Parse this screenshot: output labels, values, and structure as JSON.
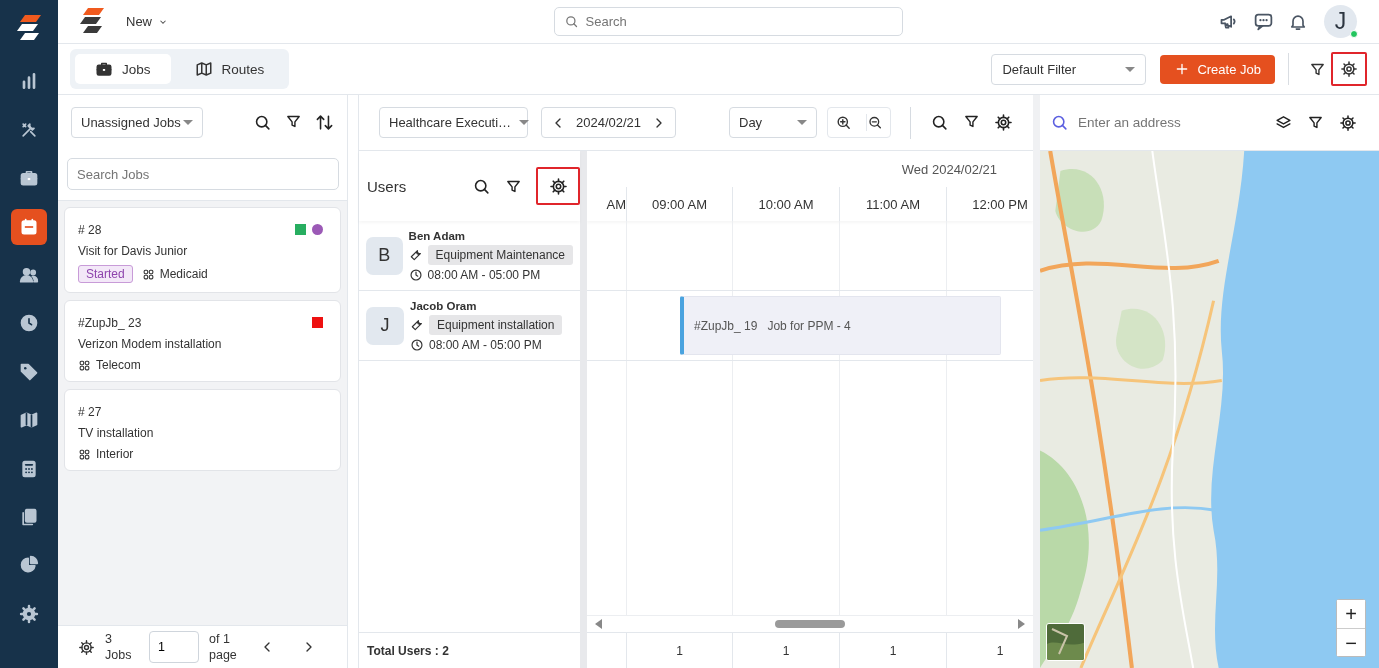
{
  "sidebar": {
    "items": [
      {
        "selected": false
      },
      {
        "selected": false
      },
      {
        "selected": false
      },
      {
        "selected": true
      },
      {
        "selected": false
      },
      {
        "selected": false
      },
      {
        "selected": false
      },
      {
        "selected": false
      },
      {
        "selected": false
      },
      {
        "selected": false
      },
      {
        "selected": false
      },
      {
        "selected": false
      }
    ]
  },
  "topbar": {
    "menu": "New",
    "search": {
      "placeholder": "Search"
    },
    "avatar": {
      "initial": "J",
      "online": true
    }
  },
  "toolbar": {
    "tabs": [
      {
        "label": "Jobs",
        "selected": true
      },
      {
        "label": "Routes",
        "selected": false
      }
    ],
    "filter_select": "Default Filter",
    "create_button": "Create Job",
    "settings_highlighted": true
  },
  "jobs_panel": {
    "view_select": "Unassigned Jobs",
    "search": {
      "placeholder": "Search Jobs"
    },
    "jobs": [
      {
        "number": "# 28",
        "title": "Visit for Davis Junior",
        "status": "Started",
        "category": "Medicaid",
        "markers": [
          {
            "kind": "square",
            "color": "#27ae60"
          },
          {
            "kind": "circle",
            "color": "#9b59b6"
          }
        ]
      },
      {
        "number": "#ZupJb_ 23",
        "title": "Verizon Modem installation",
        "category": "Telecom",
        "markers": [
          {
            "kind": "square",
            "color": "#ee1111"
          }
        ]
      },
      {
        "number": "# 27",
        "title": "TV installation",
        "category": "Interior"
      }
    ],
    "footer": {
      "count": "3 Jobs",
      "page": "1",
      "of": "of 1 page"
    }
  },
  "scheduler": {
    "team_select": "Healthcare Executi…",
    "date": "2024/02/21",
    "view_select": "Day",
    "users_title": "Users",
    "users_settings_highlighted": true,
    "day_label": "Wed 2024/02/21",
    "hours": [
      "AM",
      "09:00 AM",
      "10:00 AM",
      "11:00 AM",
      "12:00 PM"
    ],
    "users": [
      {
        "initial": "B",
        "name": "Ben Adam",
        "skill": "Equipment Maintenance",
        "hours": "08:00 AM - 05:00 PM"
      },
      {
        "initial": "J",
        "name": "Jacob Oram",
        "skill": "Equipment installation",
        "hours": "08:00 AM - 05:00 PM",
        "events": [
          {
            "number": "#ZupJb_ 19",
            "title": "Job for PPM - 4"
          }
        ]
      }
    ],
    "total": "Total Users : 2",
    "counts": [
      "1",
      "1",
      "1",
      "1"
    ]
  },
  "map": {
    "search": {
      "placeholder": "Enter an address"
    },
    "zoom_in": "+",
    "zoom_out": "−"
  }
}
